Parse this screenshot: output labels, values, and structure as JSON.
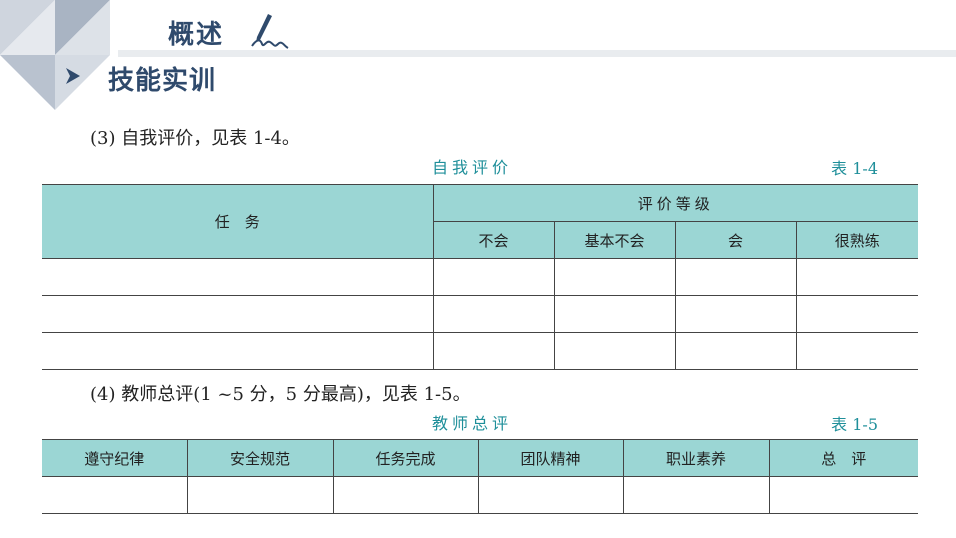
{
  "header": {
    "title": "概述",
    "section_title": "技能实训"
  },
  "self_eval": {
    "step": "(3) 自我评价，见表 1-4。",
    "caption": "自我评价",
    "table_no": "表 1-4",
    "task_header": "任　务",
    "grade_header": "评价等级",
    "grades": [
      "不会",
      "基本不会",
      "会",
      "很熟练"
    ],
    "rows": [
      [
        "",
        "",
        "",
        "",
        ""
      ],
      [
        "",
        "",
        "",
        "",
        ""
      ],
      [
        "",
        "",
        "",
        "",
        ""
      ]
    ]
  },
  "teacher_eval": {
    "step": "(4) 教师总评(1 ~5 分，5 分最高)，见表 1-5。",
    "caption": "教师总评",
    "table_no": "表 1-5",
    "columns": [
      "遵守纪律",
      "安全规范",
      "任务完成",
      "团队精神",
      "职业素养",
      "总　评"
    ],
    "rows": [
      [
        "",
        "",
        "",
        "",
        "",
        ""
      ]
    ]
  },
  "colors": {
    "header_text": "#2f4a6c",
    "table_header": "#9bd6d4",
    "caption": "#1f8f9a"
  },
  "icons": [
    "pen-icon",
    "arrow-right-icon"
  ]
}
